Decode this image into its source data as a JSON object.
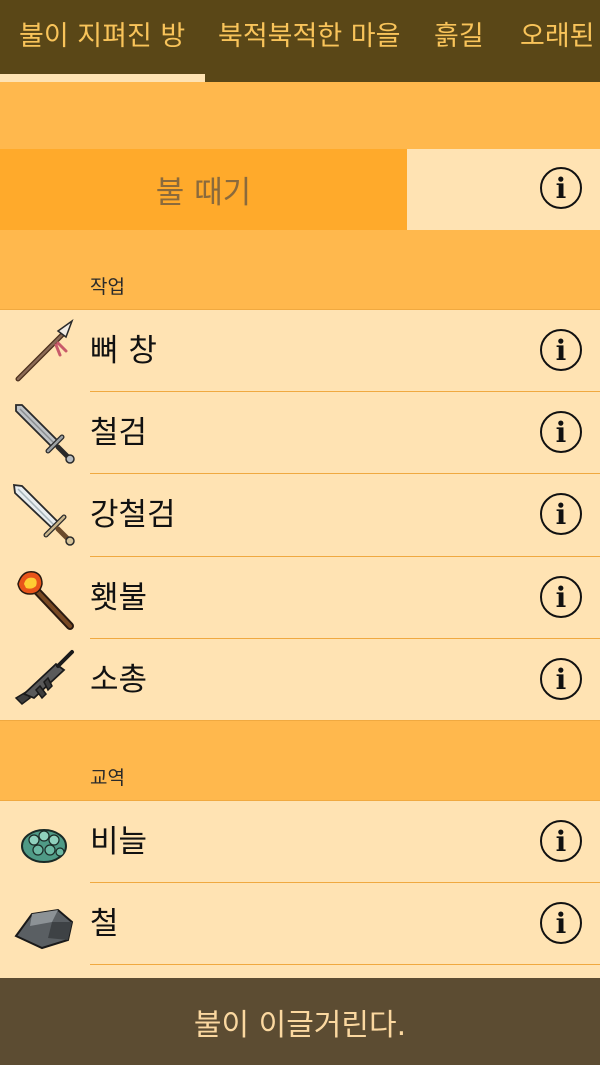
{
  "tabs": [
    {
      "label": "불이 지펴진 방",
      "active": true
    },
    {
      "label": "북적북적한 마을",
      "active": false
    },
    {
      "label": "흙길",
      "active": false
    },
    {
      "label": "오래된",
      "active": false
    }
  ],
  "fire": {
    "button_label": "불 때기",
    "info_glyph": "i"
  },
  "sections": {
    "craft_label": "작업",
    "trade_label": "교역"
  },
  "craft_items": [
    {
      "label": "뼈 창",
      "icon": "bone-spear-icon"
    },
    {
      "label": "철검",
      "icon": "iron-sword-icon"
    },
    {
      "label": "강철검",
      "icon": "steel-sword-icon"
    },
    {
      "label": "횃불",
      "icon": "torch-icon"
    },
    {
      "label": "소총",
      "icon": "rifle-icon"
    }
  ],
  "trade_items": [
    {
      "label": "비늘",
      "icon": "scales-icon"
    },
    {
      "label": "철",
      "icon": "iron-ore-icon"
    }
  ],
  "footer": {
    "message": "불이 이글거린다."
  },
  "colors": {
    "tabbar_bg": "#5a4717",
    "tab_text": "#f9c45a",
    "page_bg": "#ffe3b3",
    "section_band": "#ffb84d",
    "fire_button": "#ffaa2b",
    "footer_bg": "#5c4c32",
    "footer_text": "#fbd8a0"
  }
}
